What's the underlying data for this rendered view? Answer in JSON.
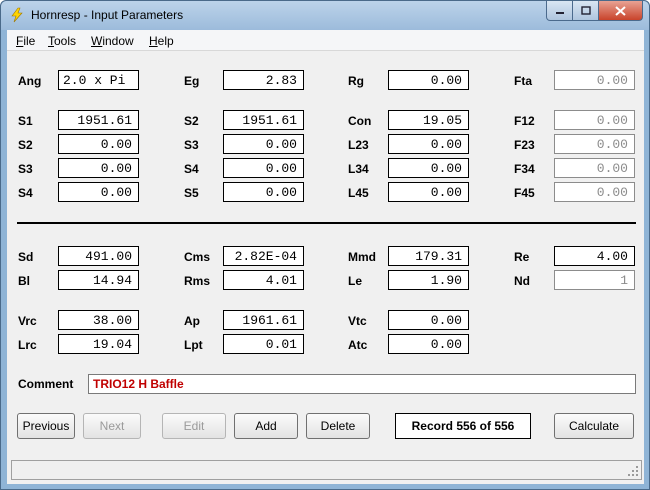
{
  "window": {
    "title": "Hornresp - Input Parameters"
  },
  "menu": [
    "File",
    "Tools",
    "Window",
    "Help"
  ],
  "fields": {
    "ang": {
      "label": "Ang",
      "value": "2.0 x Pi"
    },
    "eg": {
      "label": "Eg",
      "value": "2.83"
    },
    "rg": {
      "label": "Rg",
      "value": "0.00"
    },
    "fta": {
      "label": "Fta",
      "value": "0.00"
    },
    "s1a": {
      "label": "S1",
      "value": "1951.61"
    },
    "s2a": {
      "label": "S2",
      "value": "1951.61"
    },
    "con": {
      "label": "Con",
      "value": "19.05"
    },
    "f12": {
      "label": "F12",
      "value": "0.00"
    },
    "s2b": {
      "label": "S2",
      "value": "0.00"
    },
    "s3b": {
      "label": "S3",
      "value": "0.00"
    },
    "l23": {
      "label": "L23",
      "value": "0.00"
    },
    "f23": {
      "label": "F23",
      "value": "0.00"
    },
    "s3c": {
      "label": "S3",
      "value": "0.00"
    },
    "s4c": {
      "label": "S4",
      "value": "0.00"
    },
    "l34": {
      "label": "L34",
      "value": "0.00"
    },
    "f34": {
      "label": "F34",
      "value": "0.00"
    },
    "s4d": {
      "label": "S4",
      "value": "0.00"
    },
    "s5d": {
      "label": "S5",
      "value": "0.00"
    },
    "l45": {
      "label": "L45",
      "value": "0.00"
    },
    "f45": {
      "label": "F45",
      "value": "0.00"
    },
    "sd": {
      "label": "Sd",
      "value": "491.00"
    },
    "cms": {
      "label": "Cms",
      "value": "2.82E-04"
    },
    "mmd": {
      "label": "Mmd",
      "value": "179.31"
    },
    "re": {
      "label": "Re",
      "value": "4.00"
    },
    "bl": {
      "label": "Bl",
      "value": "14.94"
    },
    "rms": {
      "label": "Rms",
      "value": "4.01"
    },
    "le": {
      "label": "Le",
      "value": "1.90"
    },
    "nd": {
      "label": "Nd",
      "value": "1"
    },
    "vrc": {
      "label": "Vrc",
      "value": "38.00"
    },
    "ap": {
      "label": "Ap",
      "value": "1961.61"
    },
    "vtc": {
      "label": "Vtc",
      "value": "0.00"
    },
    "lrc": {
      "label": "Lrc",
      "value": "19.04"
    },
    "lpt": {
      "label": "Lpt",
      "value": "0.01"
    },
    "atc": {
      "label": "Atc",
      "value": "0.00"
    }
  },
  "comment": {
    "label": "Comment",
    "value": "TRIO12 H Baffle"
  },
  "buttons": {
    "previous": "Previous",
    "next": "Next",
    "edit": "Edit",
    "add": "Add",
    "delete": "Delete",
    "calculate": "Calculate"
  },
  "record": "Record 556 of 556",
  "colors": {
    "comment_text": "#c00000",
    "close_button": "#c9442b"
  }
}
